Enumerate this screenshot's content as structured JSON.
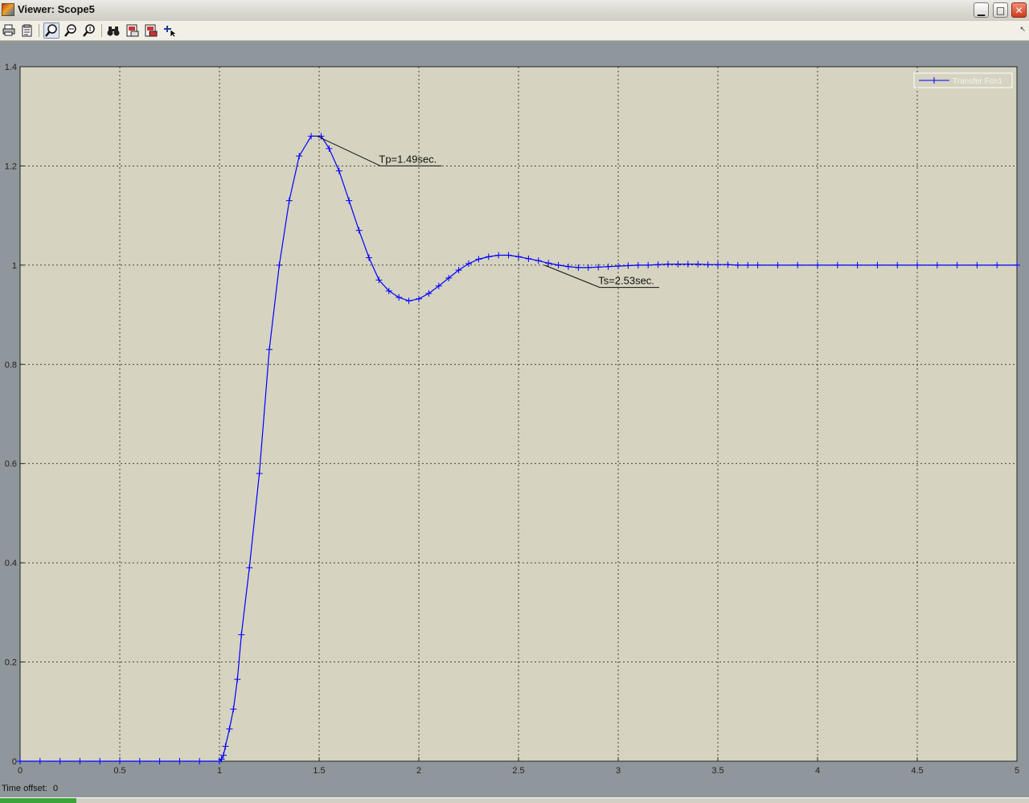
{
  "window": {
    "title": "Viewer: Scope5",
    "minimize_glyph": "▁",
    "maximize_glyph": "□",
    "close_glyph": "✕"
  },
  "toolbar": {
    "buttons": [
      {
        "name": "print-button",
        "icon": "printer-icon"
      },
      {
        "name": "parameters-button",
        "icon": "parameters-icon"
      },
      {
        "name": "zoom-button",
        "icon": "magnifier-icon",
        "active": true
      },
      {
        "name": "zoom-x-button",
        "icon": "zoom-x-icon"
      },
      {
        "name": "zoom-y-button",
        "icon": "zoom-y-icon"
      },
      {
        "name": "autoscale-button",
        "icon": "binoculars-icon"
      },
      {
        "name": "save-axes-button",
        "icon": "save-axes-icon"
      },
      {
        "name": "restore-axes-button",
        "icon": "restore-axes-icon"
      },
      {
        "name": "legend-button",
        "icon": "legend-cursor-icon"
      }
    ]
  },
  "status": {
    "time_offset_label": "Time offset:",
    "time_offset_value": "0"
  },
  "colors": {
    "plot_background": "#d6d3c0",
    "frame_background": "#8f979c",
    "series": "#0000ff"
  },
  "chart_data": {
    "type": "line",
    "title": "",
    "xlabel": "",
    "ylabel": "",
    "xlim": [
      0,
      5
    ],
    "ylim": [
      0,
      1.4
    ],
    "xticks": [
      "0",
      "0.5",
      "1",
      "1.5",
      "2",
      "2.5",
      "3",
      "3.5",
      "4",
      "4.5",
      "5"
    ],
    "yticks": [
      "0",
      "0.2",
      "0.4",
      "0.6",
      "0.8",
      "1",
      "1.2",
      "1.4"
    ],
    "grid": true,
    "legend_position": "top-right",
    "markers": "plus",
    "series": [
      {
        "name": "Transfer Fcn1",
        "x": [
          0,
          0.1,
          0.2,
          0.3,
          0.4,
          0.5,
          0.6,
          0.7,
          0.8,
          0.9,
          1.0,
          1.01,
          1.02,
          1.03,
          1.05,
          1.07,
          1.09,
          1.11,
          1.15,
          1.2,
          1.25,
          1.3,
          1.35,
          1.4,
          1.46,
          1.51,
          1.55,
          1.6,
          1.65,
          1.7,
          1.75,
          1.8,
          1.85,
          1.9,
          1.95,
          2.0,
          2.05,
          2.1,
          2.15,
          2.2,
          2.25,
          2.3,
          2.35,
          2.4,
          2.45,
          2.5,
          2.55,
          2.6,
          2.65,
          2.7,
          2.75,
          2.8,
          2.85,
          2.9,
          2.95,
          3.0,
          3.05,
          3.1,
          3.15,
          3.2,
          3.25,
          3.3,
          3.35,
          3.4,
          3.45,
          3.5,
          3.55,
          3.6,
          3.65,
          3.7,
          3.8,
          3.9,
          4.0,
          4.1,
          4.2,
          4.3,
          4.4,
          4.5,
          4.6,
          4.7,
          4.8,
          4.9,
          5.0
        ],
        "y": [
          0,
          0,
          0,
          0,
          0,
          0,
          0,
          0,
          0,
          0,
          0,
          0.004,
          0.012,
          0.03,
          0.065,
          0.105,
          0.165,
          0.255,
          0.39,
          0.58,
          0.83,
          1.0,
          1.13,
          1.22,
          1.26,
          1.26,
          1.235,
          1.19,
          1.13,
          1.07,
          1.015,
          0.97,
          0.948,
          0.935,
          0.928,
          0.932,
          0.943,
          0.958,
          0.974,
          0.99,
          1.003,
          1.012,
          1.017,
          1.02,
          1.02,
          1.017,
          1.013,
          1.009,
          1.004,
          1.0,
          0.997,
          0.995,
          0.995,
          0.996,
          0.997,
          0.998,
          0.999,
          1.0,
          1.0,
          1.001,
          1.002,
          1.002,
          1.002,
          1.002,
          1.001,
          1.001,
          1.001,
          1.0,
          1.0,
          1.0,
          1.0,
          1.0,
          1.0,
          1.0,
          1.0,
          1.0,
          1.0,
          1.0,
          1.0,
          1.0,
          1.0,
          1.0,
          1.0
        ]
      }
    ],
    "annotations": [
      {
        "text": "Tp=1.49sec.",
        "point": [
          1.49,
          1.26
        ],
        "label_at": [
          1.8,
          1.2
        ]
      },
      {
        "text": "Ts=2.53sec.",
        "point": [
          2.63,
          1.0
        ],
        "label_at": [
          2.9,
          0.955
        ]
      }
    ]
  }
}
